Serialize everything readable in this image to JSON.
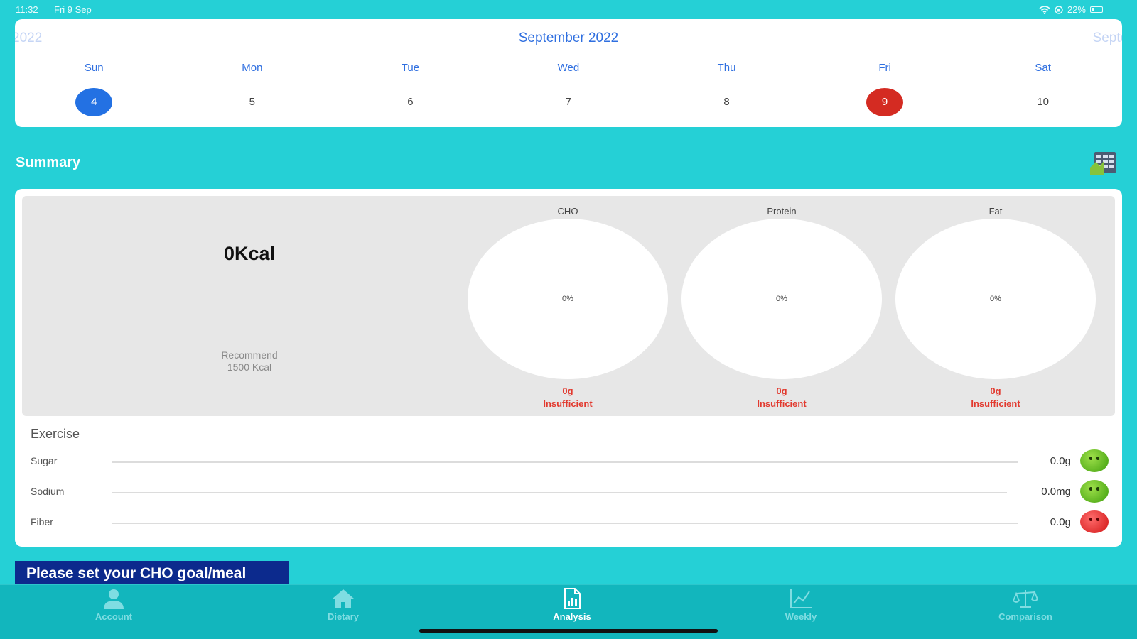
{
  "status_bar": {
    "time": "11:32",
    "date": "Fri 9 Sep",
    "battery": "22%"
  },
  "calendar": {
    "prev_month": "2022",
    "current_month": "September 2022",
    "next_month": "Septem",
    "days": [
      {
        "name": "Sun",
        "num": "4",
        "state": "selected"
      },
      {
        "name": "Mon",
        "num": "5",
        "state": ""
      },
      {
        "name": "Tue",
        "num": "6",
        "state": ""
      },
      {
        "name": "Wed",
        "num": "7",
        "state": ""
      },
      {
        "name": "Thu",
        "num": "8",
        "state": ""
      },
      {
        "name": "Fri",
        "num": "9",
        "state": "today"
      },
      {
        "name": "Sat",
        "num": "10",
        "state": ""
      }
    ]
  },
  "summary": {
    "title": "Summary",
    "kcal": "0Kcal",
    "recommend_line1": "Recommend",
    "recommend_line2": "1500 Kcal",
    "macros": [
      {
        "label": "CHO",
        "percent": "0%",
        "amount": "0g",
        "status": "Insufficient"
      },
      {
        "label": "Protein",
        "percent": "0%",
        "amount": "0g",
        "status": "Insufficient"
      },
      {
        "label": "Fat",
        "percent": "0%",
        "amount": "0g",
        "status": "Insufficient"
      }
    ],
    "exercise_title": "Exercise",
    "nutrients": [
      {
        "label": "Sugar",
        "value": "0.0g",
        "face": "good"
      },
      {
        "label": "Sodium",
        "value": "0.0mg",
        "face": "good"
      },
      {
        "label": "Fiber",
        "value": "0.0g",
        "face": "bad"
      }
    ]
  },
  "goal_button": "Please set your CHO goal/meal",
  "tabs": [
    {
      "label": "Account",
      "icon": "person-icon",
      "active": false
    },
    {
      "label": "Dietary",
      "icon": "home-icon",
      "active": false
    },
    {
      "label": "Analysis",
      "icon": "document-icon",
      "active": true
    },
    {
      "label": "Weekly",
      "icon": "chart-icon",
      "active": false
    },
    {
      "label": "Comparison",
      "icon": "scale-icon",
      "active": false
    }
  ],
  "colors": {
    "background": "#25d0d6",
    "accent_blue": "#2371e3",
    "today_red": "#d42b22",
    "button_navy": "#0c2a8d",
    "insufficient_red": "#e23a2f"
  }
}
